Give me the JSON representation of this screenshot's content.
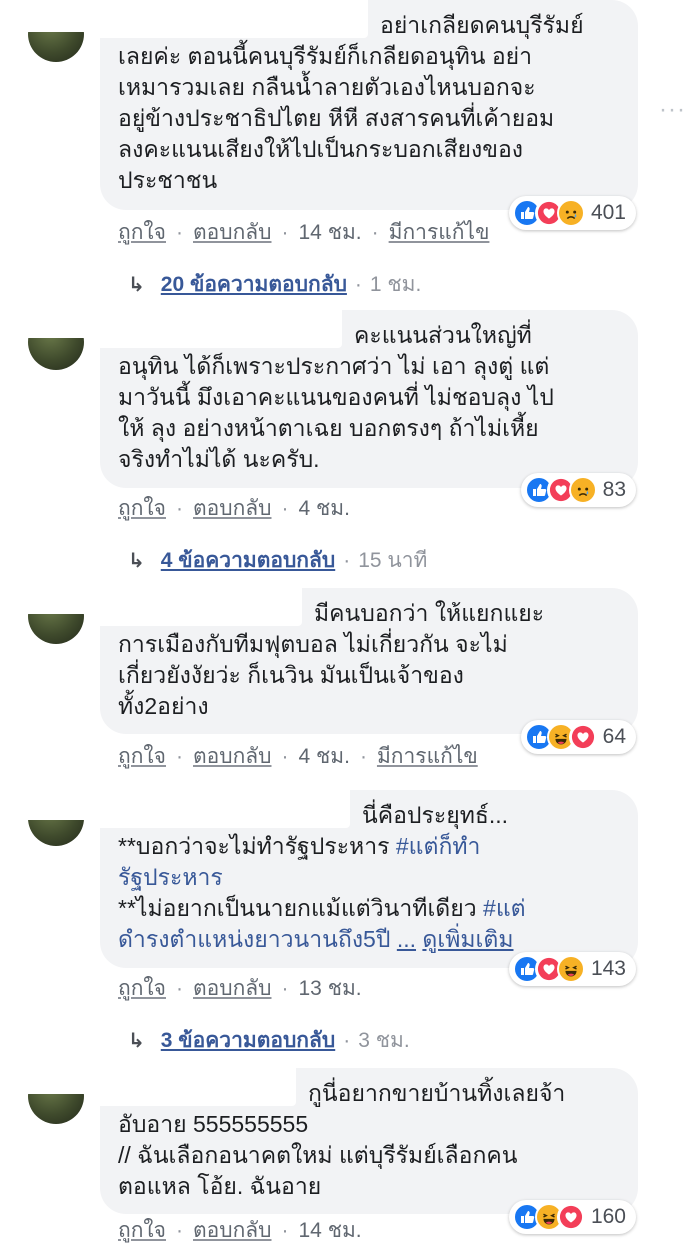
{
  "comments": [
    {
      "text_first": "อย่าเกลียดคนบุรีรัมย์",
      "text_rest": "เลยค่ะ ตอนนี้คนบุรีรัมย์ก็เกลียดอนุทิน อย่า\nเหมารวมเลย กลืนน้ำลายตัวเองไหนบอกจะ\nอยู่ข้างประชาธิปไตย หีหี สงสารคนที่เค้ายอม\nลงคะแนนเสียงให้ไปเป็นกระบอกเสียงของ\nประชาชน",
      "reactions": [
        "like-icon",
        "love-icon",
        "sad-icon"
      ],
      "reaction_count": "401",
      "like": "ถูกใจ",
      "reply": "ตอบกลับ",
      "time": "14 ชม.",
      "edited": "มีการแก้ไข",
      "replies_label": "20 ข้อความตอบกลับ",
      "replies_time": "1 ชม."
    },
    {
      "text_first": "คะแนนส่วนใหญ่ที่",
      "text_rest": "อนุทิน ได้ก็เพราะประกาศว่า ไม่ เอา ลุงตู่ แต่\nมาวันนี้ มึงเอาคะแนนของคนที่ ไม่ชอบลุง ไป\nให้ ลุง อย่างหน้าตาเฉย บอกตรงๆ ถ้าไม่เหี้ย\nจริงทำไม่ได้ นะครับ.",
      "reactions": [
        "like-icon",
        "love-icon",
        "sad-icon"
      ],
      "reaction_count": "83",
      "like": "ถูกใจ",
      "reply": "ตอบกลับ",
      "time": "4 ชม.",
      "replies_label": "4 ข้อความตอบกลับ",
      "replies_time": "15 นาที"
    },
    {
      "text_first": "มีคนบอกว่า ให้แยกแยะ",
      "text_rest": "การเมืองกับทีมฟุตบอล ไม่เกี่ยวกัน จะไม่\nเกี่ยวยังงัยว่ะ ก็เนวิน มันเป็นเจ้าของ\nทั้ง2อย่าง",
      "reactions": [
        "like-icon",
        "haha-icon",
        "love-icon"
      ],
      "reaction_count": "64",
      "like": "ถูกใจ",
      "reply": "ตอบกลับ",
      "time": "4 ชม.",
      "edited": "มีการแก้ไข"
    },
    {
      "text_first": "นี่คือประยุทธ์...",
      "line2_pre": "**บอกว่าจะไม่ทำรัฐประหาร ",
      "line2_tag": "#แต่ก็ทำ",
      "line3_tag": "รัฐประหาร",
      "line4_pre": "**ไม่อยากเป็นนายกแม้แต่วินาทีเดียว ",
      "line4_tag": "#แต่",
      "line5_tag": "ดำรงตำแหน่งยาวนานถึง5ปี",
      "ellipsis": "...",
      "see_more": "ดูเพิ่มเติม",
      "reactions": [
        "like-icon",
        "love-icon",
        "haha-icon"
      ],
      "reaction_count": "143",
      "like": "ถูกใจ",
      "reply": "ตอบกลับ",
      "time": "13 ชม.",
      "replies_label": "3 ข้อความตอบกลับ",
      "replies_time": "3 ชม."
    },
    {
      "text_first": "กูนี่อยากขายบ้านทิ้งเลยจ้า",
      "text_rest": "อับอาย 555555555\n// ฉันเลือกอนาคตใหม่ แต่บุรีรัมย์เลือกคน\nตอแหล โอ้ย. ฉันอาย",
      "reactions": [
        "like-icon",
        "haha-icon",
        "love-icon"
      ],
      "reaction_count": "160",
      "like": "ถูกใจ",
      "reply": "ตอบกลับ",
      "time": "14 ชม."
    }
  ],
  "more_options": "···",
  "colors": {
    "link": "#385898",
    "bubble": "#f2f3f5",
    "like": "#1877f2",
    "love": "#f33e58",
    "sad": "#f7b125"
  }
}
